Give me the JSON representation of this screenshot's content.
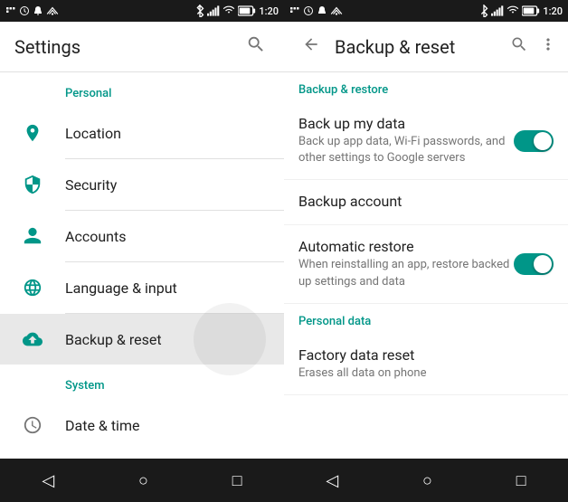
{
  "left": {
    "statusBar": {
      "time": "1:20"
    },
    "appBar": {
      "title": "Settings",
      "searchIcon": "🔍"
    },
    "sections": [
      {
        "label": "Personal",
        "items": [
          {
            "id": "location",
            "icon": "location",
            "text": "Location"
          },
          {
            "id": "security",
            "icon": "security",
            "text": "Security"
          },
          {
            "id": "accounts",
            "icon": "accounts",
            "text": "Accounts"
          },
          {
            "id": "language",
            "icon": "language",
            "text": "Language & input"
          },
          {
            "id": "backup",
            "icon": "backup",
            "text": "Backup & reset",
            "active": true
          }
        ]
      },
      {
        "label": "System",
        "items": [
          {
            "id": "datetime",
            "icon": "datetime",
            "text": "Date & time"
          }
        ]
      }
    ]
  },
  "right": {
    "statusBar": {
      "time": "1:20"
    },
    "appBar": {
      "title": "Backup & reset",
      "backIcon": "←",
      "searchIcon": "⋮"
    },
    "sections": [
      {
        "id": "backup-restore",
        "label": "Backup & restore",
        "items": [
          {
            "id": "back-up-data",
            "title": "Back up my data",
            "subtitle": "Back up app data, Wi-Fi passwords, and other settings to Google servers",
            "toggle": true,
            "toggleOn": true
          },
          {
            "id": "backup-account",
            "title": "Backup account",
            "subtitle": "",
            "toggle": false
          },
          {
            "id": "auto-restore",
            "title": "Automatic restore",
            "subtitle": "When reinstalling an app, restore backed up settings and data",
            "toggle": true,
            "toggleOn": true
          }
        ]
      },
      {
        "id": "personal-data",
        "label": "Personal data",
        "items": [
          {
            "id": "factory-reset",
            "title": "Factory data reset",
            "subtitle": "Erases all data on phone",
            "toggle": false
          }
        ]
      }
    ],
    "navBar": {
      "back": "◁",
      "home": "○",
      "recent": "□"
    }
  },
  "navBar": {
    "back": "◁",
    "home": "○",
    "recent": "□"
  }
}
